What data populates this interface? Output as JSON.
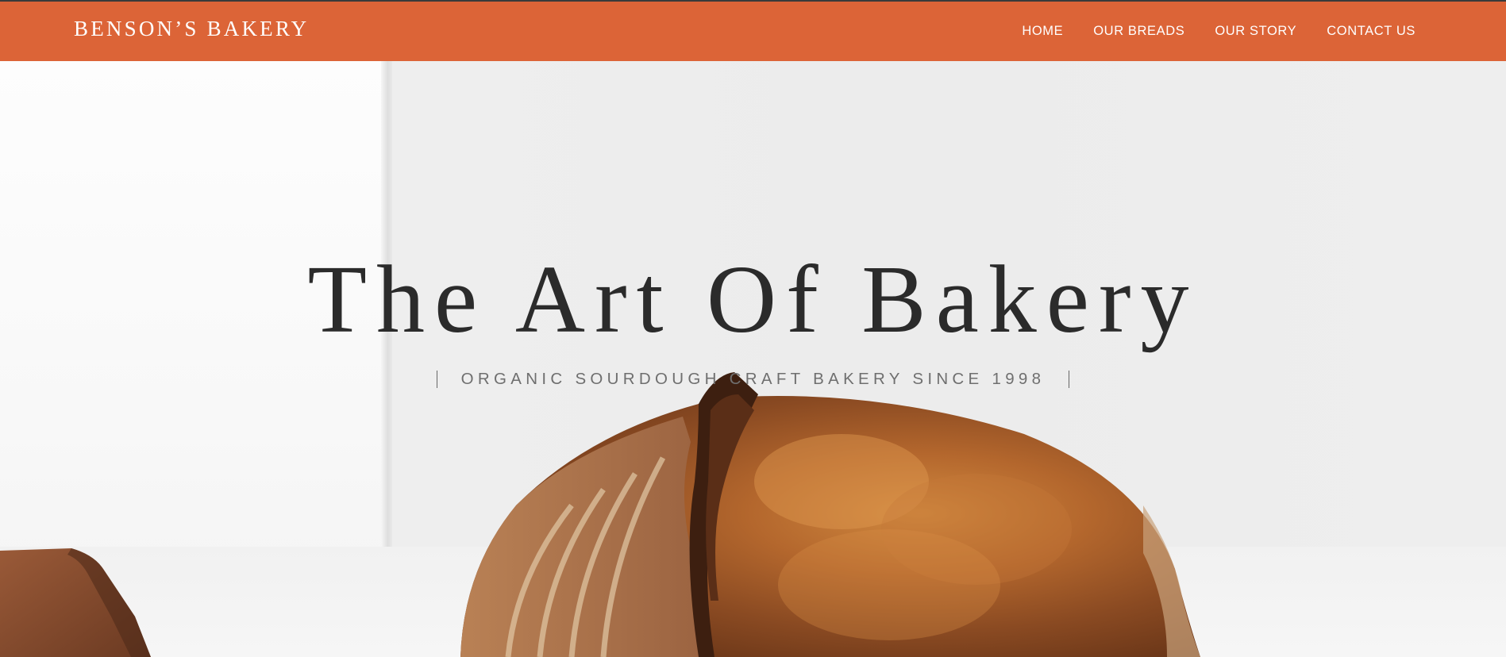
{
  "header": {
    "logo": "BENSON’S BAKERY",
    "nav": [
      {
        "label": "HOME"
      },
      {
        "label": "OUR BREADS"
      },
      {
        "label": "OUR STORY"
      },
      {
        "label": "CONTACT US"
      }
    ]
  },
  "hero": {
    "title": "The Art Of Bakery",
    "subtitle": "ORGANIC SOURDOUGH CRAFT BAKERY SINCE 1998"
  },
  "colors": {
    "brand": "#dc6437",
    "title_text": "#2b2b2b",
    "subtitle_text": "#6f6f6f"
  }
}
